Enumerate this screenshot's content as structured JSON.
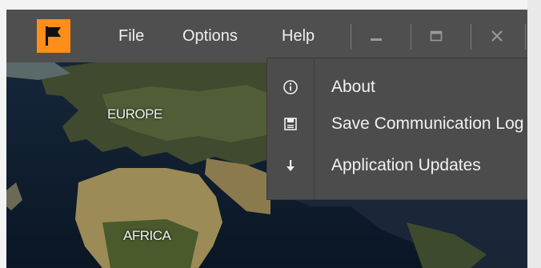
{
  "menubar": {
    "file_label": "File",
    "options_label": "Options",
    "help_label": "Help"
  },
  "help_menu": {
    "items": [
      {
        "label": "About",
        "icon": "info-icon"
      },
      {
        "label": "Save Communication Log",
        "icon": "save-log-icon"
      },
      {
        "label": "Application Updates",
        "icon": "download-arrow-icon"
      }
    ]
  },
  "map": {
    "europe_label": "EUROPE",
    "africa_label": "AFRICA"
  },
  "colors": {
    "titlebar": "#4f4f4f",
    "logo_accent": "#ff8d1a",
    "menu_bg": "#4c4c4c",
    "text": "#f1f1f1"
  }
}
